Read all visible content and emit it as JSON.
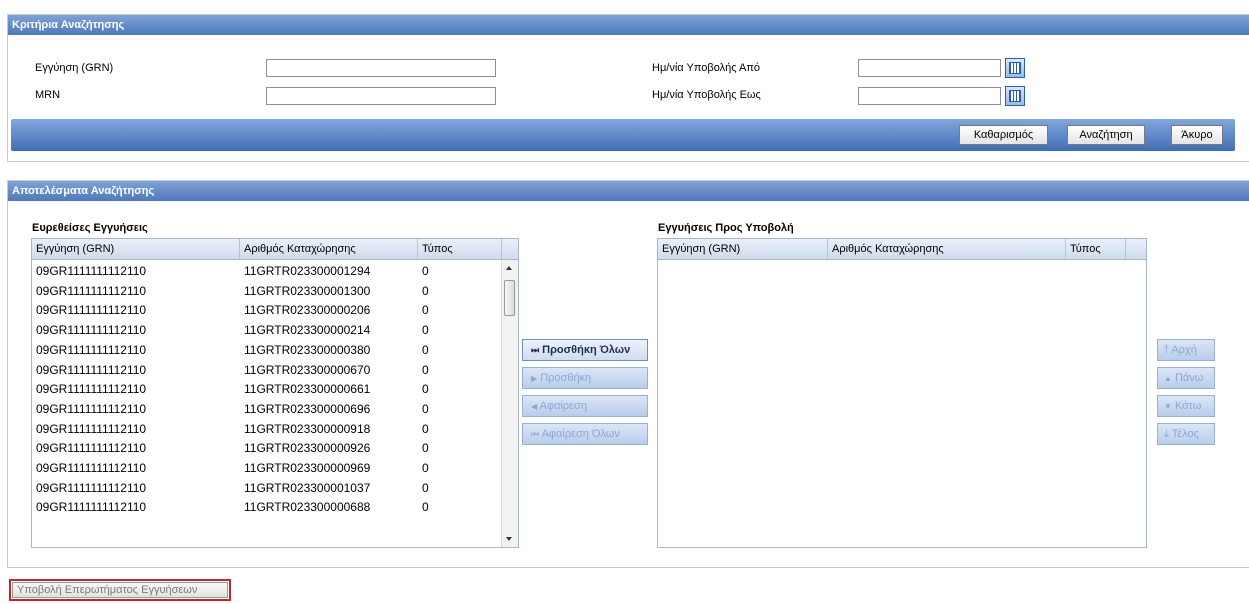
{
  "search": {
    "title": "Κριτήρια Αναζήτησης",
    "grn_label": "Εγγύηση (GRN)",
    "grn_value": "",
    "mrn_label": "MRN",
    "mrn_value": "",
    "date_from_label": "Ημ/νία Υποβολής Από",
    "date_from_value": "",
    "date_to_label": "Ημ/νία Υποβολής Εως",
    "date_to_value": "",
    "calendar_icon": "calendar-icon",
    "clear_label": "Καθαρισμός",
    "search_label": "Αναζήτηση",
    "cancel_label": "Άκυρο"
  },
  "results": {
    "title": "Αποτελέσματα Αναζήτησης",
    "found": {
      "title": "Ευρεθείσες Εγγυήσεις",
      "columns": [
        "Εγγύηση (GRN)",
        "Αριθμός Καταχώρησης",
        "Τύπος"
      ],
      "rows": [
        [
          "09GR1111111112110",
          "11GRTR023300001294",
          "0"
        ],
        [
          "09GR1111111112110",
          "11GRTR023300001300",
          "0"
        ],
        [
          "09GR1111111112110",
          "11GRTR023300000206",
          "0"
        ],
        [
          "09GR1111111112110",
          "11GRTR023300000214",
          "0"
        ],
        [
          "09GR1111111112110",
          "11GRTR023300000380",
          "0"
        ],
        [
          "09GR1111111112110",
          "11GRTR023300000670",
          "0"
        ],
        [
          "09GR1111111112110",
          "11GRTR023300000661",
          "0"
        ],
        [
          "09GR1111111112110",
          "11GRTR023300000696",
          "0"
        ],
        [
          "09GR1111111112110",
          "11GRTR023300000918",
          "0"
        ],
        [
          "09GR1111111112110",
          "11GRTR023300000926",
          "0"
        ],
        [
          "09GR1111111112110",
          "11GRTR023300000969",
          "0"
        ],
        [
          "09GR1111111112110",
          "11GRTR023300001037",
          "0"
        ],
        [
          "09GR1111111112110",
          "11GRTR023300000688",
          "0"
        ]
      ]
    },
    "transfer": {
      "add_all": "Προσθήκη Όλων",
      "add": "Προσθήκη",
      "remove": "Αφαίρεση",
      "remove_all": "Αφαίρεση Όλων"
    },
    "selected": {
      "title": "Εγγυήσεις Προς Υποβολή",
      "columns": [
        "Εγγύηση (GRN)",
        "Αριθμός Καταχώρησης",
        "Τύπος"
      ]
    },
    "order": {
      "top": "Αρχή",
      "up": "Πάνω",
      "down": "Κάτω",
      "bottom": "Τέλος"
    }
  },
  "submit_label": "Υποβολή Επερωτήματος Εγγυήσεων"
}
